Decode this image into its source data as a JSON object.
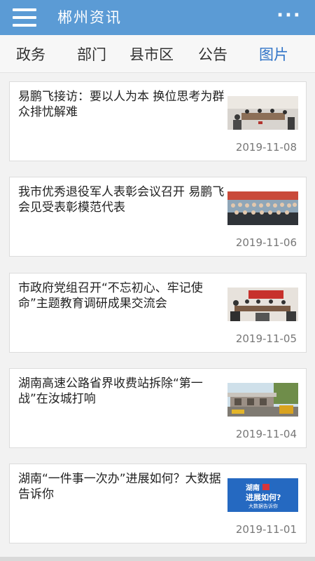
{
  "header": {
    "title": "郴州资讯",
    "menu_icon": "hamburger-icon",
    "more_icon": "more-icon",
    "more_label": "···",
    "bar_color": "#5b9bd5"
  },
  "tabs": [
    {
      "label": "政务"
    },
    {
      "label": "部门"
    },
    {
      "label": "县市区"
    },
    {
      "label": "公告"
    },
    {
      "label": "图片",
      "active": true
    }
  ],
  "articles": [
    {
      "title": "易鹏飞接访：要以人为本 换位思考为群众排忧解难",
      "date": "2019-11-08"
    },
    {
      "title": "我市优秀退役军人表彰会议召开 易鹏飞会见受表彰模范代表",
      "date": "2019-11-06"
    },
    {
      "title": "市政府党组召开“不忘初心、牢记使命”主题教育调研成果交流会",
      "date": "2019-11-05"
    },
    {
      "title": "湖南高速公路省界收费站拆除“第一战”在汝城打响",
      "date": "2019-11-04"
    },
    {
      "title": "湖南“一件事一次办”进展如何？大数据告诉你",
      "date": "2019-11-01",
      "thumb_text": "湖南 进展如何? 大数据告诉你"
    }
  ]
}
